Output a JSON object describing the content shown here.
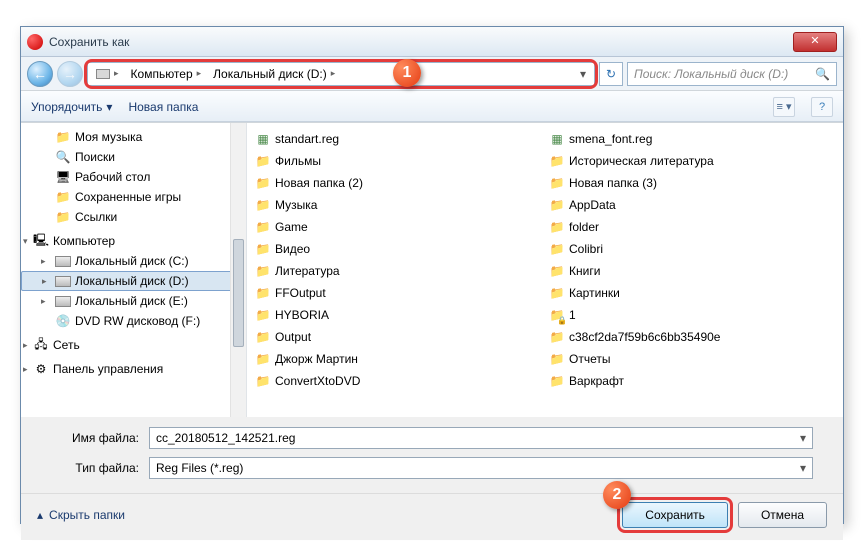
{
  "title": "Сохранить как",
  "breadcrumb": {
    "computer": "Компьютер",
    "disk": "Локальный диск (D:)"
  },
  "search_placeholder": "Поиск: Локальный диск (D:)",
  "toolbar": {
    "organize": "Упорядочить",
    "new_folder": "Новая папка"
  },
  "tree": {
    "my_music": "Моя музыка",
    "searches": "Поиски",
    "desktop": "Рабочий стол",
    "saved_games": "Сохраненные игры",
    "links": "Ссылки",
    "computer": "Компьютер",
    "disk_c": "Локальный диск (C:)",
    "disk_d": "Локальный диск (D:)",
    "disk_e": "Локальный диск (E:)",
    "dvd": "DVD RW дисковод (F:)",
    "network": "Сеть",
    "control_panel": "Панель управления"
  },
  "files_col1": [
    {
      "icon": "reg",
      "name": "standart.reg"
    },
    {
      "icon": "folder",
      "name": "Фильмы"
    },
    {
      "icon": "folder",
      "name": "Новая папка (2)"
    },
    {
      "icon": "folder",
      "name": "Музыка"
    },
    {
      "icon": "folder",
      "name": "Game"
    },
    {
      "icon": "folder",
      "name": "Видео"
    },
    {
      "icon": "folder",
      "name": "Литература"
    },
    {
      "icon": "folder",
      "name": "FFOutput"
    },
    {
      "icon": "folder",
      "name": "HYBORIA"
    },
    {
      "icon": "folder",
      "name": "Output"
    },
    {
      "icon": "folder",
      "name": "Джорж Мартин"
    },
    {
      "icon": "folder",
      "name": "ConvertXtoDVD"
    }
  ],
  "files_col2": [
    {
      "icon": "reg",
      "name": "smena_font.reg"
    },
    {
      "icon": "folder",
      "name": "Историческая литература"
    },
    {
      "icon": "folder",
      "name": "Новая папка (3)"
    },
    {
      "icon": "folder",
      "name": "AppData"
    },
    {
      "icon": "folder",
      "name": "folder"
    },
    {
      "icon": "folder",
      "name": "Colibri"
    },
    {
      "icon": "folder",
      "name": "Книги"
    },
    {
      "icon": "folder",
      "name": "Картинки"
    },
    {
      "icon": "lockfolder",
      "name": "1"
    },
    {
      "icon": "folder",
      "name": "c38cf2da7f59b6c6bb35490e"
    },
    {
      "icon": "folder",
      "name": "Отчеты"
    },
    {
      "icon": "folder",
      "name": "Варкрафт"
    }
  ],
  "form": {
    "filename_label": "Имя файла:",
    "filename_value": "cc_20180512_142521.reg",
    "filetype_label": "Тип файла:",
    "filetype_value": "Reg Files (*.reg)"
  },
  "footer": {
    "hide_folders": "Скрыть папки",
    "save": "Сохранить",
    "cancel": "Отмена"
  },
  "markers": {
    "one": "1",
    "two": "2"
  }
}
